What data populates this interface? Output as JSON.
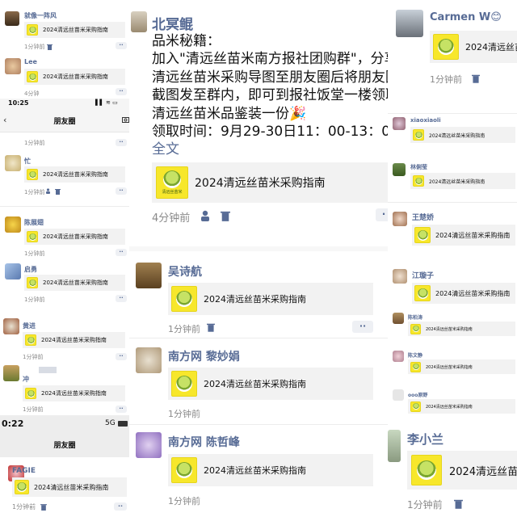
{
  "card_title": "2024清远丝苗米采购指南",
  "logo_caption": "清远丝苗米",
  "nav_title": "朋友圈",
  "colors": {
    "name": "#576b95",
    "card_bg": "#f2f2f2",
    "logo": "#f7e72b",
    "time": "#8a8a8a"
  },
  "icons": [
    "trash-icon",
    "person-icon",
    "more-dots-icon",
    "back-chevron-icon",
    "camera-icon"
  ],
  "left_panel": {
    "status_top": {
      "time": "10:25",
      "right": "▌▌ ≋ ▭"
    },
    "status_bottom": {
      "time": "0:22",
      "network": "5G"
    },
    "posts": [
      {
        "name": "就像一阵风",
        "time": "1分钟前"
      },
      {
        "name": "Lee",
        "time": "4分钟"
      },
      {
        "name": "",
        "time": "1分钟前"
      },
      {
        "name": "忙",
        "time": "1分钟前"
      },
      {
        "name": "陈展翅",
        "time": "1分钟前"
      },
      {
        "name": "启勇",
        "time": "1分钟前"
      },
      {
        "name": "黄进",
        "time": "1分钟前"
      },
      {
        "name": "冲",
        "time": "1分钟前"
      },
      {
        "name": "FAGIE",
        "time": "1分钟前"
      }
    ]
  },
  "center_panel": {
    "main_post": {
      "name": "北冥鲲",
      "lines": [
        "品米秘籍：",
        "加入\"清远丝苗米南方报社团购群\"，分享",
        "清远丝苗米采购导图至朋友圈后将朋友圈",
        "截图发至群内，即可到报社饭堂一楼领取",
        "清远丝苗米品鉴装一份🎉",
        "领取时间：9月29-30日11：00-13：00，"
      ],
      "full_text": "全文",
      "time": "4分钟前"
    },
    "posts": [
      {
        "name": "吴诗航",
        "time": "1分钟前"
      },
      {
        "name": "南方网 黎妙娟",
        "time": "1分钟前"
      },
      {
        "name": "南方网 陈哲峰",
        "time": "1分钟前"
      }
    ]
  },
  "right_panel": {
    "posts": [
      {
        "name": "Carmen W😊",
        "time": "1分钟前"
      },
      {
        "name": "xiaoxiaoli",
        "time": ""
      },
      {
        "name": "林俐莹",
        "time": ""
      },
      {
        "name": "王楚娇",
        "time": ""
      },
      {
        "name": "江璇子",
        "time": ""
      },
      {
        "name": "陈柏涛",
        "time": ""
      },
      {
        "name": "陈文静",
        "time": ""
      },
      {
        "name": "ooo原野",
        "time": ""
      },
      {
        "name": "李小兰",
        "time": "1分钟前"
      }
    ]
  }
}
